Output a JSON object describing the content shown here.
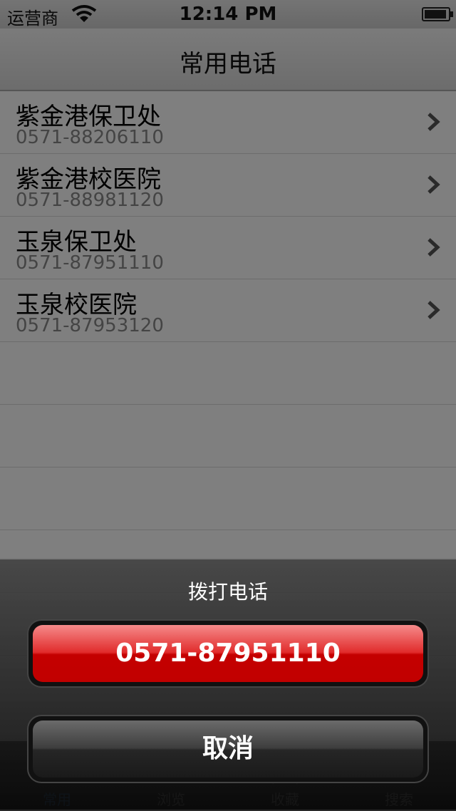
{
  "status_bar": {
    "carrier": "运营商",
    "time": "12:14 PM"
  },
  "nav": {
    "title": "常用电话"
  },
  "contacts": [
    {
      "name": "紫金港保卫处",
      "phone": "0571-88206110"
    },
    {
      "name": "紫金港校医院",
      "phone": "0571-88981120"
    },
    {
      "name": "玉泉保卫处",
      "phone": "0571-87951110"
    },
    {
      "name": "玉泉校医院",
      "phone": "0571-87953120"
    }
  ],
  "tabs": [
    {
      "label": "常用",
      "icon": "phone-icon",
      "active": true
    },
    {
      "label": "浏览",
      "icon": "eye-icon",
      "active": false
    },
    {
      "label": "收藏",
      "icon": "star-icon",
      "active": false
    },
    {
      "label": "搜索",
      "icon": "search-icon",
      "active": false
    }
  ],
  "action_sheet": {
    "title": "拨打电话",
    "call_label": "0571-87951110",
    "cancel_label": "取消"
  },
  "colors": {
    "active_tab": "#2f7fd6",
    "call_button": "#c40000"
  }
}
